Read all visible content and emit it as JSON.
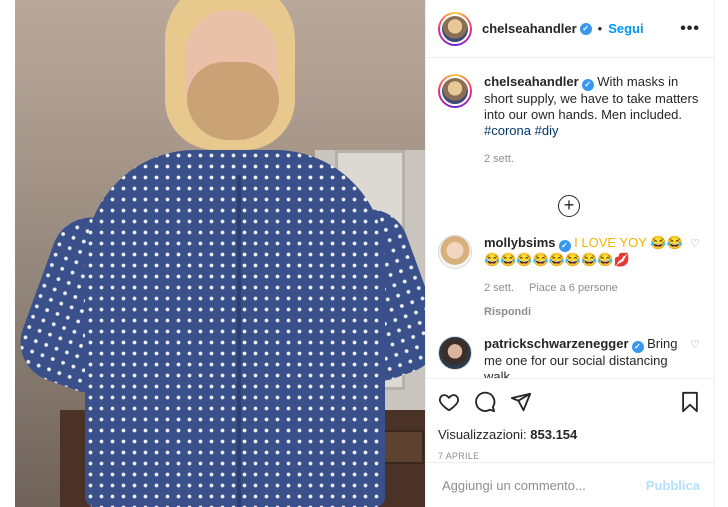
{
  "post": {
    "author": "chelseahandler",
    "follow_label": "Segui",
    "more_icon": "more-horizontal-icon",
    "dot": "•"
  },
  "caption": {
    "author": "chelseahandler",
    "text": "With masks in short supply, we have to take matters into our own hands. Men included.",
    "hashtags": [
      "#corona",
      "#diy"
    ],
    "age": "2 sett."
  },
  "load_more_icon": "plus-circle-icon",
  "comments": [
    {
      "author": "mollybsims",
      "text": "I LOVE YOY 😂😂",
      "text2": "😂😂😂😂😂😂😂😂💋",
      "age": "2 sett.",
      "likes": "Piace a 6 persone",
      "reply": "Rispondi"
    },
    {
      "author": "patrickschwarzenegger",
      "text": "Bring me one for our social distancing walk."
    }
  ],
  "stats": {
    "views_label": "Visualizzazioni:",
    "views_value": "853.154",
    "date": "7 APRILE"
  },
  "comment_box": {
    "placeholder": "Aggiungi un commento...",
    "publish_label": "Pubblica"
  },
  "colors": {
    "accent": "#0095f6",
    "verified": "#3897f0",
    "muted": "#8e8e8e",
    "publish_disabled": "#b2dffc"
  }
}
